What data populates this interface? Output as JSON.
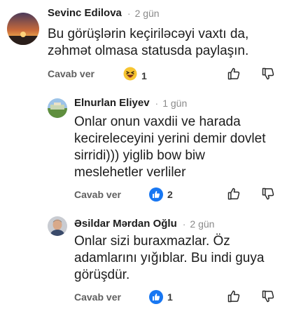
{
  "comments": [
    {
      "author": "Sevinc Edilova",
      "time": "2 gün",
      "text": "Bu görüşlərin keçiriləcəyi vaxtı da,\nzəhmət olmasa statusda paylaşın.",
      "reply_label": "Cavab ver",
      "reaction_icon": "laughing-emoji-icon",
      "reaction_count": "1"
    },
    {
      "author": "Elnurlan Eliyev",
      "time": "1 gün",
      "text": "Onlar onun vaxdii ve harada\nkecireleceyini yerini demir dovlet\nsirridi))) yiglib bow biw\nmeslehetler verliler",
      "reply_label": "Cavab ver",
      "reaction_icon": "like-icon",
      "reaction_count": "2"
    },
    {
      "author": "Əsildar Mərdan Oğlu",
      "time": "2 gün",
      "text": "Onlar sizi buraxmazlar. Öz\nadamlarını yığıblar. Bu indi guya\ngörüşdür.",
      "reply_label": "Cavab ver",
      "reaction_icon": "like-icon",
      "reaction_count": "1"
    }
  ],
  "colors": {
    "like_blue": "#1877f2",
    "emoji_yellow": "#f7c531"
  }
}
